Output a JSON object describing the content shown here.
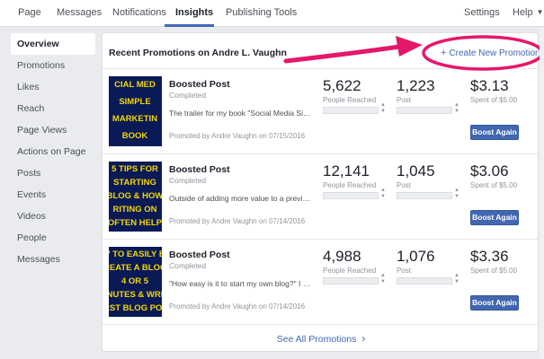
{
  "topnav": {
    "tabs": [
      {
        "label": "Page"
      },
      {
        "label": "Messages"
      },
      {
        "label": "Notifications"
      },
      {
        "label": "Insights"
      },
      {
        "label": "Publishing Tools"
      }
    ],
    "settings_label": "Settings",
    "help_label": "Help",
    "active_tab": "Insights"
  },
  "sidebar": {
    "items": [
      {
        "label": "Overview"
      },
      {
        "label": "Promotions"
      },
      {
        "label": "Likes"
      },
      {
        "label": "Reach"
      },
      {
        "label": "Page Views"
      },
      {
        "label": "Actions on Page"
      },
      {
        "label": "Posts"
      },
      {
        "label": "Events"
      },
      {
        "label": "Videos"
      },
      {
        "label": "People"
      },
      {
        "label": "Messages"
      }
    ],
    "active_item": "Overview"
  },
  "panel": {
    "title": "Recent Promotions on Andre L. Vaughn",
    "create_label": "Create New Promotion",
    "see_all_label": "See All Promotions"
  },
  "promotions": [
    {
      "thumb_lines": [
        "CIAL MED",
        "SIMPLE",
        "MARKETIN",
        "BOOK"
      ],
      "title": "Boosted Post",
      "status": "Completed",
      "description": "The trailer for my book \"Social Media Simple M...",
      "promoted": "Promoted by Andre Vaughn on 07/15/2016",
      "people_reached": "5,622",
      "people_reached_label": "People Reached",
      "post_value": "1,223",
      "post_label": "Post",
      "spent": "$3.13",
      "spent_label": "Spent of $5.00",
      "boost_label": "Boost Again"
    },
    {
      "thumb_lines": [
        "5 TIPS FOR",
        "STARTING",
        "BLOG & HOW",
        "RITING ON",
        "OFTEN HELP"
      ],
      "title": "Boosted Post",
      "status": "Completed",
      "description": "Outside of adding more value to a previous vide...",
      "promoted": "Promoted by Andre Vaughn on 07/14/2016",
      "people_reached": "12,141",
      "people_reached_label": "People Reached",
      "post_value": "1,045",
      "post_label": "Post",
      "spent": "$3.06",
      "spent_label": "Spent of $5.00",
      "boost_label": "Boost Again"
    },
    {
      "thumb_lines": [
        "V TO EASILY B",
        "REATE A BLOG",
        "4 OR 5",
        "NUTES & WRI",
        "RST BLOG POS"
      ],
      "title": "Boosted Post",
      "status": "Completed",
      "description": "\"How easy is it to start my own blog?\" I have an...",
      "promoted": "Promoted by Andre Vaughn on 07/14/2016",
      "people_reached": "4,988",
      "people_reached_label": "People Reached",
      "post_value": "1,076",
      "post_label": "Post",
      "spent": "$3.36",
      "spent_label": "Spent of $5.00",
      "boost_label": "Boost Again"
    }
  ],
  "colors": {
    "accent": "#4267b2",
    "annotation": "#e5176b",
    "thumb_bg": "#0a1a57",
    "thumb_text": "#f4d600"
  },
  "icons": {
    "create": "plus-icon",
    "see_all": "chevron-right-icon",
    "help": "caret-down-icon",
    "stepper": "up-down-stepper-icon"
  }
}
